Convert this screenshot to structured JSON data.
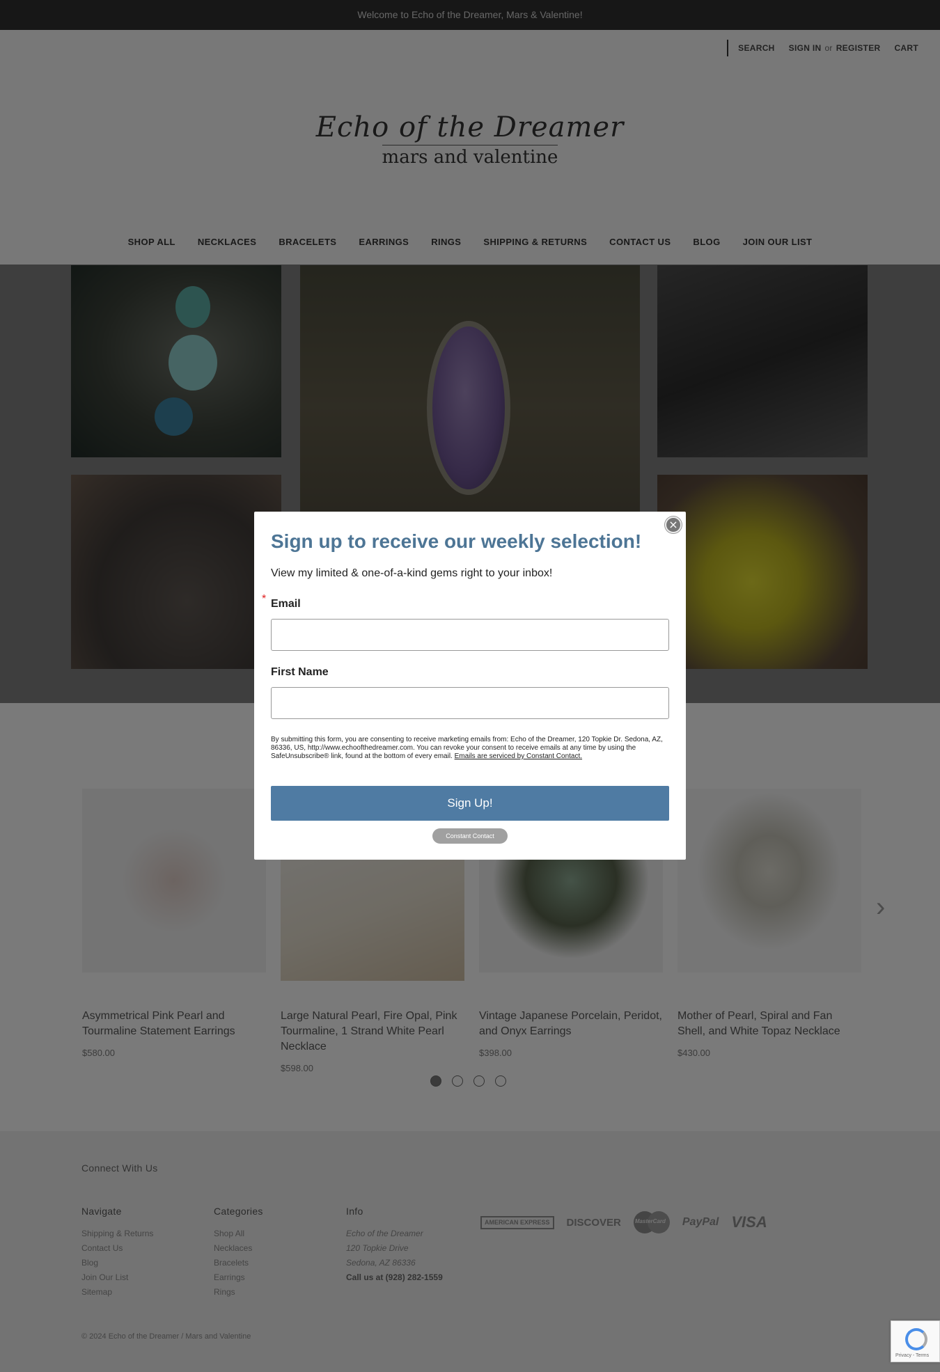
{
  "banner": {
    "text": "Welcome to Echo of the Dreamer, Mars & Valentine!"
  },
  "utility": {
    "search": "SEARCH",
    "sign_in": "SIGN IN",
    "or": "or",
    "register": "REGISTER",
    "cart": "CART"
  },
  "logo": {
    "line1": "Echo of the Dreamer",
    "line2": "mars and valentine"
  },
  "nav": [
    "SHOP ALL",
    "NECKLACES",
    "BRACELETS",
    "EARRINGS",
    "RINGS",
    "SHIPPING & RETURNS",
    "CONTACT US",
    "BLOG",
    "JOIN OUR LIST"
  ],
  "products": [
    {
      "title": "Asymmetrical Pink Pearl and Tourmaline Statement Earrings",
      "price": "$580.00"
    },
    {
      "title": "Large Natural Pearl, Fire Opal, Pink Tourmaline, 1 Strand White Pearl Necklace",
      "price": "$598.00"
    },
    {
      "title": "Vintage Japanese Porcelain, Peridot, and Onyx Earrings",
      "price": "$398.00"
    },
    {
      "title": "Mother of Pearl, Spiral and Fan Shell, and White Topaz Necklace",
      "price": "$430.00"
    }
  ],
  "carousel": {
    "next_icon": "›",
    "pages": 4,
    "active": 1
  },
  "footer": {
    "connect": "Connect With Us",
    "navigate": {
      "title": "Navigate",
      "items": [
        "Shipping & Returns",
        "Contact Us",
        "Blog",
        "Join Our List",
        "Sitemap"
      ]
    },
    "categories": {
      "title": "Categories",
      "items": [
        "Shop All",
        "Necklaces",
        "Bracelets",
        "Earrings",
        "Rings"
      ]
    },
    "info": {
      "title": "Info",
      "address": [
        "Echo of the Dreamer",
        "120 Topkie Drive",
        "Sedona, AZ 86336"
      ],
      "phone": "Call us at (928) 282-1559"
    },
    "payments": {
      "amex": "AMERICAN EXPRESS",
      "discover": "DISCOVER",
      "mastercard": "MasterCard",
      "paypal": "PayPal",
      "visa": "VISA"
    },
    "copyright": "© 2024 Echo of the Dreamer / Mars and Valentine"
  },
  "recaptcha": {
    "text": "Privacy - Terms"
  },
  "modal": {
    "title": "Sign up to receive our weekly selection!",
    "subtitle": "View my limited & one-of-a-kind gems right to your inbox!",
    "required_mark": "*",
    "email_label": "Email",
    "first_name_label": "First Name",
    "legal": "By submitting this form, you are consenting to receive marketing emails from: Echo of the Dreamer, 120 Topkie Dr. Sedona, AZ, 86336, US, http://www.echoofthedreamer.com. You can revoke your consent to receive emails at any time by using the SafeUnsubscribe® link, found at the bottom of every email.",
    "legal_link": "Emails are serviced by Constant Contact.",
    "button": "Sign Up!",
    "badge": "Constant Contact",
    "close": "×"
  }
}
